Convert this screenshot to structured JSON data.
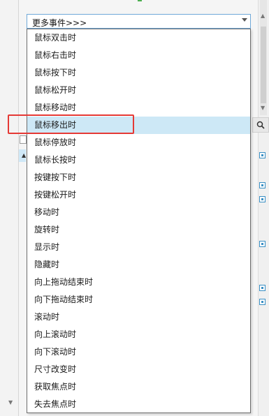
{
  "combo": {
    "selected_value": "更多事件>>>",
    "arrow_icon": "chevron-down-icon"
  },
  "dropdown": {
    "items": [
      {
        "label": "鼠标双击时"
      },
      {
        "label": "鼠标右击时"
      },
      {
        "label": "鼠标按下时"
      },
      {
        "label": "鼠标松开时"
      },
      {
        "label": "鼠标移动时"
      },
      {
        "label": "鼠标移出时"
      },
      {
        "label": "鼠标停放时"
      },
      {
        "label": "鼠标长按时"
      },
      {
        "label": "按键按下时"
      },
      {
        "label": "按键松开时"
      },
      {
        "label": "移动时"
      },
      {
        "label": "旋转时"
      },
      {
        "label": "显示时"
      },
      {
        "label": "隐藏时"
      },
      {
        "label": "向上拖动结束时"
      },
      {
        "label": "向下拖动结束时"
      },
      {
        "label": "滚动时"
      },
      {
        "label": "向上滚动时"
      },
      {
        "label": "向下滚动时"
      },
      {
        "label": "尺寸改变时"
      },
      {
        "label": "获取焦点时"
      },
      {
        "label": "失去焦点时"
      }
    ],
    "selected_index": 5
  },
  "icons": {
    "search": "search-icon",
    "scroll_up": "scroll-up-icon",
    "scroll_down": "scroll-down-icon"
  },
  "colors": {
    "selection": "#cde8f6",
    "annotation": "#e53935",
    "focus_border": "#6fa8d8"
  }
}
